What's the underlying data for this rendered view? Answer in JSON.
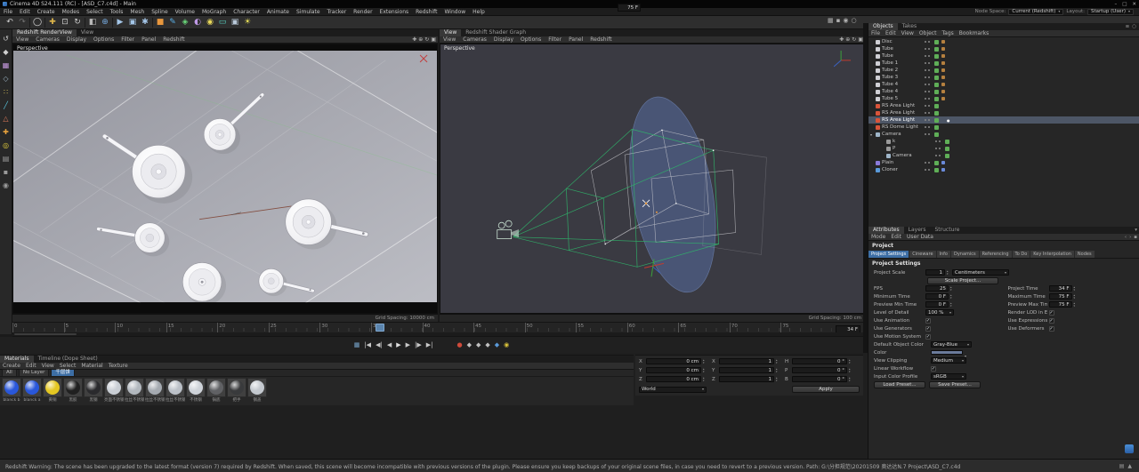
{
  "title_bar": {
    "title": "Cinema 4D S24.111 (RC) - [ASD_C7.c4d] - Main",
    "minimize": "–",
    "maximize": "□",
    "close": "✕"
  },
  "menu_bar": {
    "items": [
      "File",
      "Edit",
      "Create",
      "Modes",
      "Select",
      "Tools",
      "Mesh",
      "Spline",
      "Volume",
      "MoGraph",
      "Character",
      "Animate",
      "Simulate",
      "Tracker",
      "Render",
      "Extensions",
      "Redshift",
      "Window",
      "Help"
    ],
    "node_space_label": "Node Space:",
    "node_space_value": "Current (Redshift)",
    "layout_label": "Layout:",
    "layout_value": "Startup (User)"
  },
  "toolbar": {
    "icons": [
      {
        "name": "undo-icon",
        "glyph": "↶",
        "color": "#d0d0d0"
      },
      {
        "name": "redo-icon",
        "glyph": "↷",
        "color": "#707070"
      },
      {
        "cls": "sep"
      },
      {
        "name": "live-selection-icon",
        "glyph": "◯",
        "color": "#e0e0e0"
      },
      {
        "cls": "sep"
      },
      {
        "name": "move-tool-icon",
        "glyph": "✚",
        "color": "#dcb44a"
      },
      {
        "name": "scale-tool-icon",
        "glyph": "⊡",
        "color": "#d0d0d0"
      },
      {
        "name": "rotate-tool-icon",
        "glyph": "↻",
        "color": "#d0d0d0"
      },
      {
        "cls": "sep"
      },
      {
        "name": "last-tool-icon",
        "glyph": "◧",
        "color": "#b8b8b8"
      },
      {
        "name": "coordinate-system-icon",
        "glyph": "⊕",
        "color": "#74a8dc"
      },
      {
        "cls": "sep"
      },
      {
        "name": "render-view-button",
        "glyph": "▶",
        "color": "#a4c6e8"
      },
      {
        "name": "render-picture-viewer-button",
        "glyph": "▣",
        "color": "#a4c6e8"
      },
      {
        "name": "render-settings-button",
        "glyph": "✱",
        "color": "#a4c6e8"
      },
      {
        "cls": "sep"
      },
      {
        "name": "add-cube-button",
        "glyph": "■",
        "color": "#e8973d"
      },
      {
        "name": "add-spline-button",
        "glyph": "✎",
        "color": "#5ab0e8"
      },
      {
        "name": "add-mograph-button",
        "glyph": "◈",
        "color": "#6ad87a"
      },
      {
        "name": "add-deformer-button",
        "glyph": "◐",
        "color": "#c09ae8"
      },
      {
        "name": "add-field-button",
        "glyph": "◉",
        "color": "#e8d85a"
      },
      {
        "name": "add-floor-button",
        "glyph": "▭",
        "color": "#5ad8c8"
      },
      {
        "name": "add-camera-button",
        "glyph": "▣",
        "color": "#b8c8d8"
      },
      {
        "name": "add-light-button",
        "glyph": "☀",
        "color": "#e8e05a"
      }
    ],
    "right_icons": [
      {
        "name": "viewport-layout-icon",
        "glyph": "▦"
      },
      {
        "name": "lock-icon",
        "glyph": "▪"
      },
      {
        "name": "snapshot-icon",
        "glyph": "◉"
      },
      {
        "name": "search-icon",
        "glyph": "○"
      }
    ]
  },
  "mode_strip": {
    "icons": [
      {
        "name": "undo-mode-icon",
        "glyph": "↺",
        "color": "#c8c8c8"
      },
      {
        "name": "model-mode-icon",
        "glyph": "◆",
        "color": "#cfcfcf"
      },
      {
        "name": "texture-mode-icon",
        "glyph": "▦",
        "color": "#c79ae0"
      },
      {
        "name": "workplane-mode-icon",
        "glyph": "◇",
        "color": "#9ab0c0"
      },
      {
        "name": "points-mode-icon",
        "glyph": "∷",
        "color": "#d8c25a"
      },
      {
        "name": "edges-mode-icon",
        "glyph": "╱",
        "color": "#5ac8e0"
      },
      {
        "name": "polygons-mode-icon",
        "glyph": "△",
        "color": "#e07a5a"
      },
      {
        "name": "axis-mode-icon",
        "glyph": "✚",
        "color": "#e8a23d"
      },
      {
        "name": "snap-icon",
        "glyph": "◎",
        "color": "#e8d23d"
      },
      {
        "name": "workplane-snap-icon",
        "glyph": "▤",
        "color": "#9a9a9a"
      },
      {
        "name": "lock-workplane-icon",
        "glyph": "▪",
        "color": "#9a9a9a"
      },
      {
        "name": "viewport-solo-icon",
        "glyph": "◉",
        "color": "#9a9a9a"
      }
    ]
  },
  "viewport_nav": [
    {
      "name": "pan-view-icon",
      "glyph": "✚"
    },
    {
      "name": "zoom-view-icon",
      "glyph": "⊕"
    },
    {
      "name": "rotate-view-icon",
      "glyph": "↻"
    },
    {
      "name": "toggle-view-icon",
      "glyph": "▣"
    }
  ],
  "left_viewport": {
    "tabs": [
      {
        "label": "Redshift RenderView",
        "cls": "active"
      },
      {
        "label": "View"
      }
    ],
    "menu": [
      "View",
      "Cameras",
      "Display",
      "Options",
      "Filter",
      "Panel",
      "Redshift"
    ],
    "label": "Perspective",
    "grid_spacing": "Grid Spacing: 10000 cm"
  },
  "right_viewport": {
    "tabs": [
      {
        "label": "View",
        "cls": "active"
      },
      {
        "label": "Redshift Shader Graph"
      }
    ],
    "menu": [
      "View",
      "Cameras",
      "Display",
      "Options",
      "Filter",
      "Panel",
      "Redshift"
    ],
    "label": "Perspective",
    "grid_spacing": "Grid Spacing: 100 cm"
  },
  "objects_panel": {
    "tabs": [
      {
        "label": "Objects",
        "cls": "active"
      },
      {
        "label": "Takes"
      }
    ],
    "header_icons": [
      {
        "name": "panel-menu-icon",
        "glyph": "≡"
      },
      {
        "name": "search-icon",
        "glyph": "○"
      }
    ],
    "menu": [
      "File",
      "Edit",
      "View",
      "Object",
      "Tags",
      "Bookmarks"
    ],
    "items": [
      {
        "label": "Disc",
        "icon_name": "disc-icon",
        "icon_color": "#cfcfd4",
        "level_class": "lvl0",
        "check": "#5fae57",
        "tag_color": "#b5803f"
      },
      {
        "label": "Tube",
        "icon_name": "tube-icon",
        "icon_color": "#cfcfd4",
        "level_class": "lvl0",
        "check": "#5fae57",
        "tag_color": "#b5803f"
      },
      {
        "label": "Tube",
        "icon_name": "tube-icon",
        "icon_color": "#cfcfd4",
        "level_class": "lvl0",
        "check": "#5fae57",
        "tag_color": "#b5803f"
      },
      {
        "label": "Tube 1",
        "icon_name": "tube-icon",
        "icon_color": "#cfcfd4",
        "level_class": "lvl0",
        "check": "#5fae57",
        "tag_color": "#b5803f"
      },
      {
        "label": "Tube 2",
        "icon_name": "tube-icon",
        "icon_color": "#cfcfd4",
        "level_class": "lvl0",
        "check": "#5fae57",
        "tag_color": "#b5803f"
      },
      {
        "label": "Tube 3",
        "icon_name": "tube-icon",
        "icon_color": "#cfcfd4",
        "level_class": "lvl0",
        "check": "#5fae57",
        "tag_color": "#b5803f"
      },
      {
        "label": "Tube 4",
        "icon_name": "tube-icon",
        "icon_color": "#cfcfd4",
        "level_class": "lvl0",
        "check": "#5fae57",
        "tag_color": "#b5803f"
      },
      {
        "label": "Tube 4",
        "icon_name": "tube-icon",
        "icon_color": "#cfcfd4",
        "level_class": "lvl0",
        "check": "#5fae57",
        "tag_color": "#b5803f"
      },
      {
        "label": "Tube 5",
        "icon_name": "tube-icon",
        "icon_color": "#cfcfd4",
        "level_class": "lvl0",
        "check": "#5fae57",
        "tag_color": "#b5803f"
      },
      {
        "label": "RS Area Light",
        "icon_name": "area-light-icon",
        "icon_color": "#d9543a",
        "level_class": "lvl0",
        "check": "#5fae57"
      },
      {
        "label": "RS Area Light",
        "icon_name": "area-light-icon",
        "icon_color": "#d9543a",
        "level_class": "lvl0",
        "check": "#5fae57"
      },
      {
        "label": "RS Area Light",
        "icon_name": "area-light-icon",
        "icon_color": "#d9543a",
        "level_class": "lvl0",
        "check": "#5fae57",
        "state_class": "selected",
        "extra": "●"
      },
      {
        "label": "RS Dome Light",
        "icon_name": "dome-light-icon",
        "icon_color": "#d9543a",
        "level_class": "lvl0",
        "check": "#5fae57"
      },
      {
        "label": "Camera",
        "icon_name": "camera-icon",
        "icon_color": "#9fb6c9",
        "level_class": "lvl0",
        "arrow": "▾",
        "check": "#5fae57"
      },
      {
        "label": "k",
        "icon_name": "null-icon",
        "icon_color": "#9a9a9a",
        "level_class": "lvl1",
        "check": "#5fae57"
      },
      {
        "label": "P",
        "icon_name": "null-icon",
        "icon_color": "#9a9a9a",
        "level_class": "lvl1",
        "check": "#5fae57"
      },
      {
        "label": "Camera",
        "icon_name": "camera-icon",
        "icon_color": "#9fb6c9",
        "level_class": "lvl1",
        "check": "#5fae57"
      },
      {
        "label": "Plain",
        "icon_name": "plain-effector-icon",
        "icon_color": "#8a7ad9",
        "level_class": "lvl0",
        "check": "#5fae57",
        "tag_color": "#6a8ad9"
      },
      {
        "label": "Cloner",
        "icon_name": "cloner-icon",
        "icon_color": "#5a9ad9",
        "level_class": "lvl0",
        "check": "#5fae57",
        "tag_color": "#6a8ad9"
      }
    ]
  },
  "attributes_panel": {
    "tabs": [
      {
        "label": "Attributes",
        "cls": "active"
      },
      {
        "label": "Layers"
      },
      {
        "label": "Structure"
      }
    ],
    "header_icons": [
      {
        "name": "dock-icon",
        "glyph": "▾"
      }
    ],
    "mode_label": "Mode",
    "edit_label": "Edit",
    "userdata_label": "User Data",
    "mode_right_icons": [
      {
        "name": "back-icon",
        "glyph": "‹"
      },
      {
        "name": "forward-icon",
        "glyph": "›"
      },
      {
        "name": "pin-icon",
        "glyph": "▪"
      }
    ],
    "object_title": "Project",
    "section_tabs": [
      {
        "label": "Project Settings",
        "cls": "active"
      },
      {
        "label": "Cineware"
      },
      {
        "label": "Info"
      },
      {
        "label": "Dynamics"
      },
      {
        "label": "Referencing"
      },
      {
        "label": "To Do"
      },
      {
        "label": "Key Interpolation"
      },
      {
        "label": "Nodes"
      }
    ],
    "section_heading": "Project Settings",
    "project_scale": {
      "label": "Project Scale",
      "value": "1",
      "unit": "Centimeters"
    },
    "scale_project_button": "Scale Project...",
    "fps": {
      "label": "FPS",
      "value": "25"
    },
    "project_time": {
      "label": "Project Time",
      "value": "34 F"
    },
    "min_time": {
      "label": "Minimum Time",
      "value": "0 F"
    },
    "max_time": {
      "label": "Maximum Time",
      "value": "75 F"
    },
    "preview_min": {
      "label": "Preview Min Time",
      "value": "0 F"
    },
    "preview_max": {
      "label": "Preview Max Time",
      "value": "75 F"
    },
    "lod": {
      "label": "Level of Detail",
      "value": "100 %"
    },
    "render_lod": {
      "label": "Render LOD in Editor"
    },
    "use_animation": {
      "label": "Use Animation"
    },
    "use_expressions": {
      "label": "Use Expressions"
    },
    "use_generators": {
      "label": "Use Generators"
    },
    "use_deformers": {
      "label": "Use Deformers"
    },
    "use_motion": {
      "label": "Use Motion System"
    },
    "default_color": {
      "label": "Default Object Color",
      "value": "Gray-Blue"
    },
    "color": {
      "label": "Color",
      "swatch": "#6b7b9b"
    },
    "view_clipping": {
      "label": "View Clipping",
      "value": "Medium"
    },
    "linear_workflow": {
      "label": "Linear Workflow"
    },
    "input_profile": {
      "label": "Input Color Profile",
      "value": "sRGB"
    },
    "load_preset_button": "Load Preset...",
    "save_preset_button": "Save Preset..."
  },
  "timeline": {
    "ticks": [
      "0",
      "5",
      "10",
      "15",
      "20",
      "25",
      "30",
      "35",
      "40",
      "45",
      "50",
      "55",
      "60",
      "65",
      "70",
      "75"
    ],
    "current": 34,
    "max": 75,
    "current_frame_field": "34 F"
  },
  "playback": {
    "buttons": [
      {
        "name": "timeline-palette-icon",
        "glyph": "▦",
        "color": "#7aa8d0"
      },
      {
        "name": "goto-start-button",
        "glyph": "|◀",
        "color": "#c8c8c8"
      },
      {
        "name": "prev-key-button",
        "glyph": "◀|",
        "color": "#c8c8c8"
      },
      {
        "name": "prev-frame-button",
        "glyph": "◀",
        "color": "#c8c8c8"
      },
      {
        "name": "play-button",
        "glyph": "▶",
        "color": "#e0e0e0"
      },
      {
        "name": "next-frame-button",
        "glyph": "▶",
        "color": "#c8c8c8"
      },
      {
        "name": "next-key-button",
        "glyph": "|▶",
        "color": "#c8c8c8"
      },
      {
        "name": "goto-end-button",
        "glyph": "▶|",
        "color": "#c8c8c8"
      },
      {
        "name": "record-button",
        "glyph": "●",
        "color": "#cf4a3a",
        "cls": "gap"
      },
      {
        "name": "keyframe-position-icon",
        "glyph": "◆",
        "color": "#c0c0c0"
      },
      {
        "name": "keyframe-scale-icon",
        "glyph": "◆",
        "color": "#c0c0c0"
      },
      {
        "name": "keyframe-rotation-icon",
        "glyph": "◆",
        "color": "#c0c0c0"
      },
      {
        "name": "keyframe-param-icon",
        "glyph": "◆",
        "color": "#5a9ad9"
      },
      {
        "name": "autokey-button",
        "glyph": "◉",
        "color": "#d9c23a"
      }
    ],
    "end_field": "75 F"
  },
  "materials_panel": {
    "tabs": [
      {
        "label": "Materials",
        "cls": "active"
      },
      {
        "label": "Timeline (Dope Sheet)"
      }
    ],
    "menu": [
      "Create",
      "Edit",
      "View",
      "Select",
      "Material",
      "Texture"
    ],
    "filters": [
      {
        "label": "All"
      },
      {
        "label": "No Layer"
      },
      {
        "label": "千层饼",
        "cls": "active"
      }
    ],
    "materials": [
      {
        "name": "blanck b",
        "color": "#1e4ed8"
      },
      {
        "name": "blanck a",
        "color": "#1e4ed8"
      },
      {
        "name": "黄铜",
        "color": "#e3c416"
      },
      {
        "name": "黑胶",
        "color": "#141414"
      },
      {
        "name": "黑钢",
        "color": "#1f1f22"
      },
      {
        "name": "亮面不锈钢",
        "color": "#c6cbd2"
      },
      {
        "name": "拉丝不锈钢",
        "color": "#aeb4bb"
      },
      {
        "name": "拉丝不锈钢.1",
        "color": "#a0a6ad"
      },
      {
        "name": "拉丝不锈钢.2",
        "color": "#b7bdc4"
      },
      {
        "name": "不锈钢",
        "color": "#ccd1d7"
      },
      {
        "name": "锅底",
        "color": "#57595c"
      },
      {
        "name": "把手",
        "color": "#2e2f31"
      },
      {
        "name": "钢盖",
        "color": "#c0c5cb"
      }
    ]
  },
  "coordinates_panel": {
    "position": {
      "rows": [
        {
          "axis": "X",
          "value": "0 cm"
        },
        {
          "axis": "Y",
          "value": "0 cm"
        },
        {
          "axis": "Z",
          "value": "0 cm"
        }
      ]
    },
    "scale": {
      "rows": [
        {
          "axis": "X",
          "value": "1"
        },
        {
          "axis": "Y",
          "value": "1"
        },
        {
          "axis": "Z",
          "value": "1"
        }
      ]
    },
    "rotation": {
      "rows": [
        {
          "axis": "H",
          "value": "0 °"
        },
        {
          "axis": "P",
          "value": "0 °"
        },
        {
          "axis": "B",
          "value": "0 °"
        }
      ]
    },
    "space_value": "World",
    "apply_button": "Apply"
  },
  "status_bar": {
    "text": "Redshift Warning: The scene has been upgraded to the latest format (version 7) required by Redshift. When saved, this scene will become incompatible with previous versions of the plugin. Please ensure you keep backups of your original scene files, in case you need to revert to a previous version. Path: G:\\分担规范\\20201509 奥达达N.7 Project\\ASD_C7.c4d",
    "icons": [
      {
        "name": "console-icon",
        "glyph": "▤"
      },
      {
        "name": "warning-icon",
        "glyph": "▲"
      }
    ]
  }
}
